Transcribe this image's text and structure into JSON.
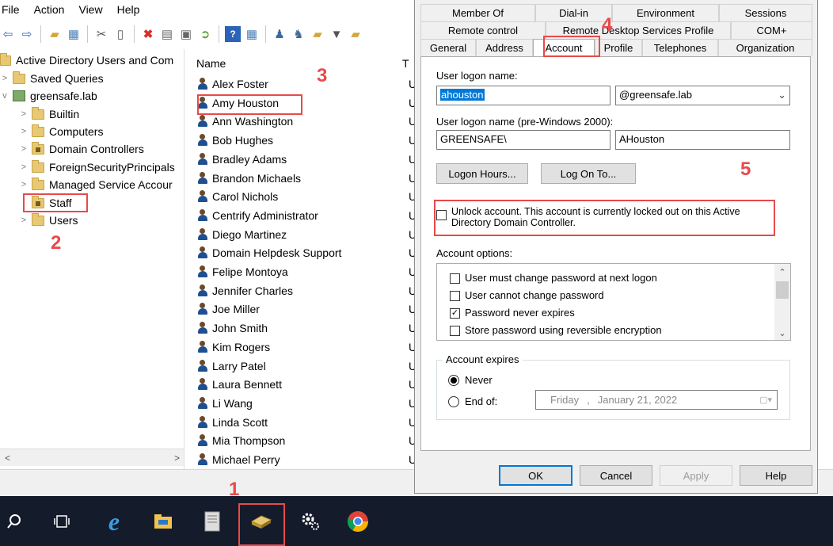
{
  "menu": [
    "File",
    "Action",
    "View",
    "Help"
  ],
  "tree": {
    "root": "Active Directory Users and Com",
    "items": [
      {
        "label": "Saved Queries",
        "level": 1,
        "arrow": ">"
      },
      {
        "label": "greensafe.lab",
        "level": 1,
        "arrow": "v"
      },
      {
        "label": "Builtin",
        "level": 2,
        "arrow": ">"
      },
      {
        "label": "Computers",
        "level": 2,
        "arrow": ">"
      },
      {
        "label": "Domain Controllers",
        "level": 2,
        "arrow": ">"
      },
      {
        "label": "ForeignSecurityPrincipals",
        "level": 2,
        "arrow": ">"
      },
      {
        "label": "Managed Service Accour",
        "level": 2,
        "arrow": ">"
      },
      {
        "label": "Staff",
        "level": 2,
        "arrow": ""
      },
      {
        "label": "Users",
        "level": 2,
        "arrow": ">"
      }
    ]
  },
  "list": {
    "col_name": "Name",
    "col_type": "T",
    "users": [
      "Alex Foster",
      "Amy Houston",
      "Ann Washington",
      "Bob Hughes",
      "Bradley Adams",
      "Brandon Michaels",
      "Carol Nichols",
      "Centrify Administrator",
      "Diego Martinez",
      "Domain Helpdesk Support",
      "Felipe Montoya",
      "Jennifer Charles",
      "Joe Miller",
      "John Smith",
      "Kim Rogers",
      "Larry Patel",
      "Laura Bennett",
      "Li Wang",
      "Linda Scott",
      "Mia Thompson",
      "Michael Perry"
    ],
    "type_letter": "U"
  },
  "dialog": {
    "tabs_row1": [
      "Member Of",
      "Dial-in",
      "Environment",
      "Sessions"
    ],
    "tabs_row2": [
      "Remote control",
      "Remote Desktop Services Profile",
      "COM+"
    ],
    "tabs_row3": [
      "General",
      "Address",
      "Account",
      "Profile",
      "Telephones",
      "Organization"
    ],
    "logon_name_label": "User logon name:",
    "logon_name_value": "ahouston",
    "domain_value": "@greensafe.lab",
    "pre2000_label": "User logon name (pre-Windows 2000):",
    "pre2000_domain": "GREENSAFE\\",
    "pre2000_user": "AHouston",
    "logon_hours": "Logon Hours...",
    "log_on_to": "Log On To...",
    "unlock_line1": "Unlock account. This account is currently locked out on this Active",
    "unlock_line2": "Directory Domain Controller.",
    "account_options_label": "Account options:",
    "options": [
      {
        "label": "User must change password at next logon",
        "checked": false
      },
      {
        "label": "User cannot change password",
        "checked": false
      },
      {
        "label": "Password never expires",
        "checked": true
      },
      {
        "label": "Store password using reversible encryption",
        "checked": false
      }
    ],
    "expires_label": "Account expires",
    "never_label": "Never",
    "endof_label": "End of:",
    "date_day": "Friday",
    "date_sep": ",",
    "date_rest": "January  21, 2022",
    "ok": "OK",
    "cancel": "Cancel",
    "apply": "Apply",
    "help": "Help"
  },
  "annotations": [
    "1",
    "2",
    "3",
    "4",
    "5"
  ],
  "colors": {
    "annotation": "#e84a4a",
    "selection": "#0078d7",
    "taskbar": "#141b2b"
  }
}
